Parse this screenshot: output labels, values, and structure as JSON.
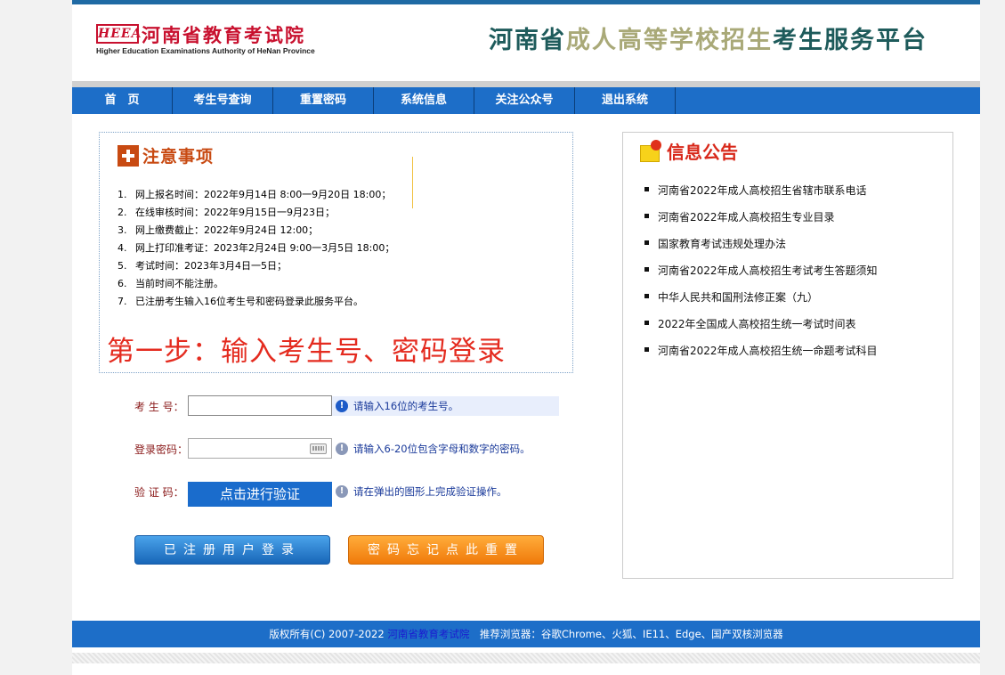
{
  "header": {
    "logo_mark": "HEEA",
    "logo_cn": "河南省教育考试院",
    "logo_en": "Higher Education Examinations Authority of HeNan Province",
    "platform_title_part1": "河南省",
    "platform_title_part2": "成人高等学校招生",
    "platform_title_part3": "考生服务平台"
  },
  "nav": {
    "items": [
      "首　页",
      "考生号查询",
      "重置密码",
      "系统信息",
      "关注公众号",
      "退出系统"
    ]
  },
  "notice": {
    "title": "注意事项",
    "items": [
      {
        "num": "1.",
        "text": "网上报名时间：2022年9月14日 8:00一9月20日 18:00；"
      },
      {
        "num": "2.",
        "text": "在线审核时间：2022年9月15日一9月23日；"
      },
      {
        "num": "3.",
        "text": "网上缴费截止：2022年9月24日 12:00；"
      },
      {
        "num": "4.",
        "text": "网上打印准考证：2023年2月24日 9:00一3月5日 18:00；"
      },
      {
        "num": "5.",
        "text": "考试时间：2023年3月4日一5日；"
      },
      {
        "num": "6.",
        "text": "当前时间不能注册。"
      },
      {
        "num": "7.",
        "text": "已注册考生输入16位考生号和密码登录此服务平台。"
      }
    ],
    "step_text": "第一步：输入考生号、密码登录"
  },
  "form": {
    "exam_no_label": "考 生 号：",
    "exam_no_value": "",
    "exam_no_hint": "请输入16位的考生号。",
    "password_label": "登录密码：",
    "password_value": "",
    "password_hint": "请输入6-20位包含字母和数字的密码。",
    "verify_label": "验 证 码：",
    "verify_button": "点击进行验证",
    "verify_hint": "请在弹出的图形上完成验证操作。",
    "info_glyph": "!",
    "login_button": "已注册用户登录",
    "reset_button": "密码忘记点此重置"
  },
  "announcements": {
    "title": "信息公告",
    "items": [
      "河南省2022年成人高校招生省辖市联系电话",
      "河南省2022年成人高校招生专业目录",
      "国家教育考试违规处理办法",
      "河南省2022年成人高校招生考试考生答题须知",
      "中华人民共和国刑法修正案（九）",
      "2022年全国成人高校招生统一考试时间表",
      "河南省2022年成人高校招生统一命题考试科目"
    ]
  },
  "footer": {
    "copyright": "版权所有(C) 2007-2022 ",
    "org_link": "河南省教育考试院",
    "browsers": "　推荐浏览器：谷歌Chrome、火狐、IE11、Edge、国产双核浏览器"
  },
  "colors": {
    "nav_blue": "#1d6ec8",
    "brand_red": "#c8102e",
    "title_green": "#1e5b5b",
    "title_khaki": "#a9a978",
    "step_red": "#e42b1f",
    "login_blue": "#1866b8",
    "reset_orange": "#f07a0a"
  }
}
